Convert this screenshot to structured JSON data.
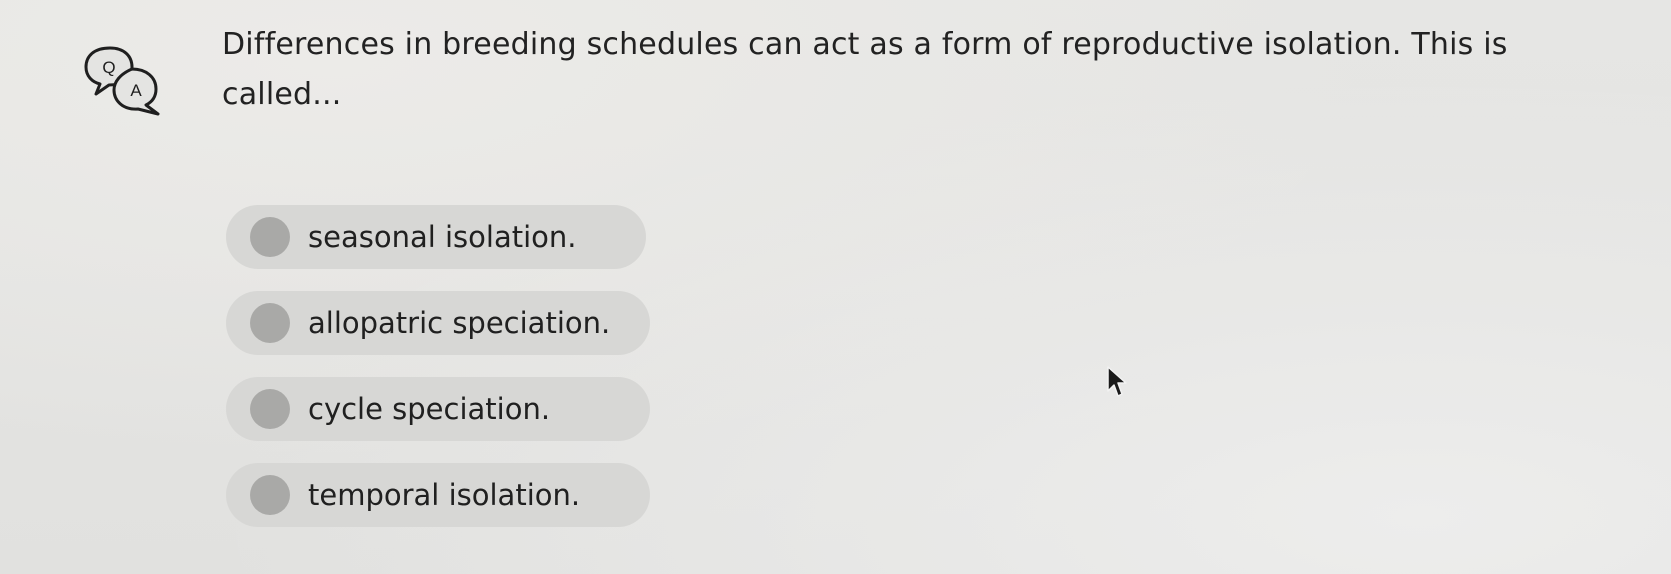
{
  "question": {
    "icon": "question-answer-bubbles-icon",
    "icon_letters": [
      "Q",
      "A"
    ],
    "text": "Differences in breeding schedules can act as a form of reproductive isolation. This is called..."
  },
  "options": [
    {
      "label": "seasonal isolation."
    },
    {
      "label": "allopatric speciation."
    },
    {
      "label": "cycle speciation."
    },
    {
      "label": "temporal isolation."
    }
  ],
  "cursor": {
    "icon": "mouse-pointer-icon"
  },
  "colors": {
    "background": "#e4e4e2",
    "option_background": "#d7d7d5",
    "radio": "#a9a9a7",
    "text": "#222222"
  }
}
